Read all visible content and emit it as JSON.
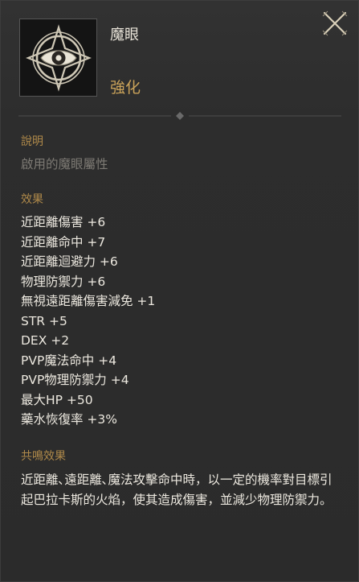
{
  "item": {
    "name": "魔眼",
    "tag": "強化"
  },
  "icons": {
    "item_icon": "eye-emblem-icon",
    "close": "close-icon"
  },
  "description": {
    "label": "說明",
    "text": "啟用的魔眼屬性"
  },
  "effects": {
    "label": "效果",
    "items": [
      "近距離傷害 +6",
      "近距離命中 +7",
      "近距離迴避力 +6",
      "物理防禦力 +6",
      "無視遠距離傷害減免 +1",
      "STR +5",
      "DEX +2",
      "PVP魔法命中 +4",
      "PVP物理防禦力 +4",
      "最大HP +50",
      "藥水恢復率 +3%"
    ]
  },
  "resonance": {
    "label": "共鳴效果",
    "text": "近距離､遠距離､魔法攻擊命中時，以一定的機率對目標引起巴拉卡斯的火焰，使其造成傷害，並減少物理防禦力。"
  },
  "colors": {
    "background": "#2b2b2b",
    "accent_gold": "#c9a259",
    "section_label": "#b08a4a",
    "muted_text": "#7d7a74",
    "body_text": "#ece8df"
  }
}
